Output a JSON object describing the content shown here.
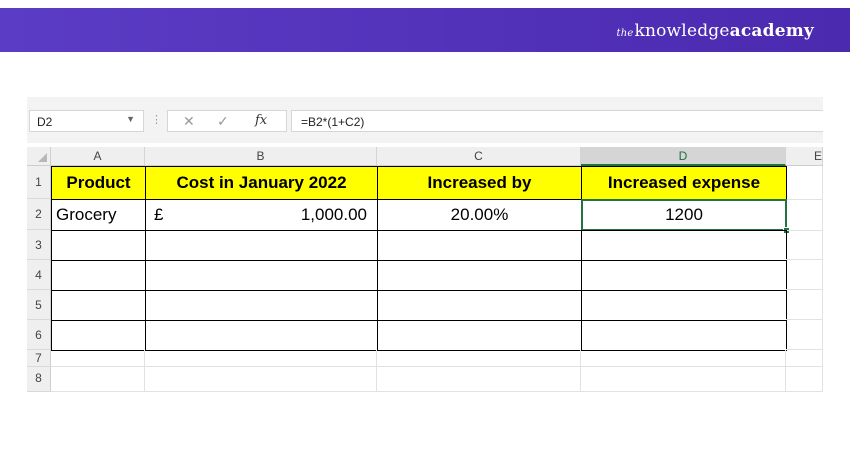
{
  "brand": {
    "prefix": "the",
    "mid": "knowledge",
    "suffix": "academy"
  },
  "formula_bar": {
    "name_box": "D2",
    "cancel_icon": "✕",
    "enter_icon": "✓",
    "fx_label": "fx",
    "formula": "=B2*(1+C2)"
  },
  "columns": [
    "A",
    "B",
    "C",
    "D",
    "E"
  ],
  "selected_column": "D",
  "rows": [
    "1",
    "2",
    "3",
    "4",
    "5",
    "6",
    "7",
    "8"
  ],
  "cells": {
    "A1": "Product",
    "B1": "Cost in January 2022",
    "C1": "Increased by",
    "D1": "Increased expense",
    "A2": "Grocery",
    "B2_currency": "£",
    "B2_value": "1,000.00",
    "C2": "20.00%",
    "D2": "1200"
  },
  "colors": {
    "banner": "#5b3cc4",
    "header_fill": "#ffff00",
    "selection": "#217346"
  }
}
